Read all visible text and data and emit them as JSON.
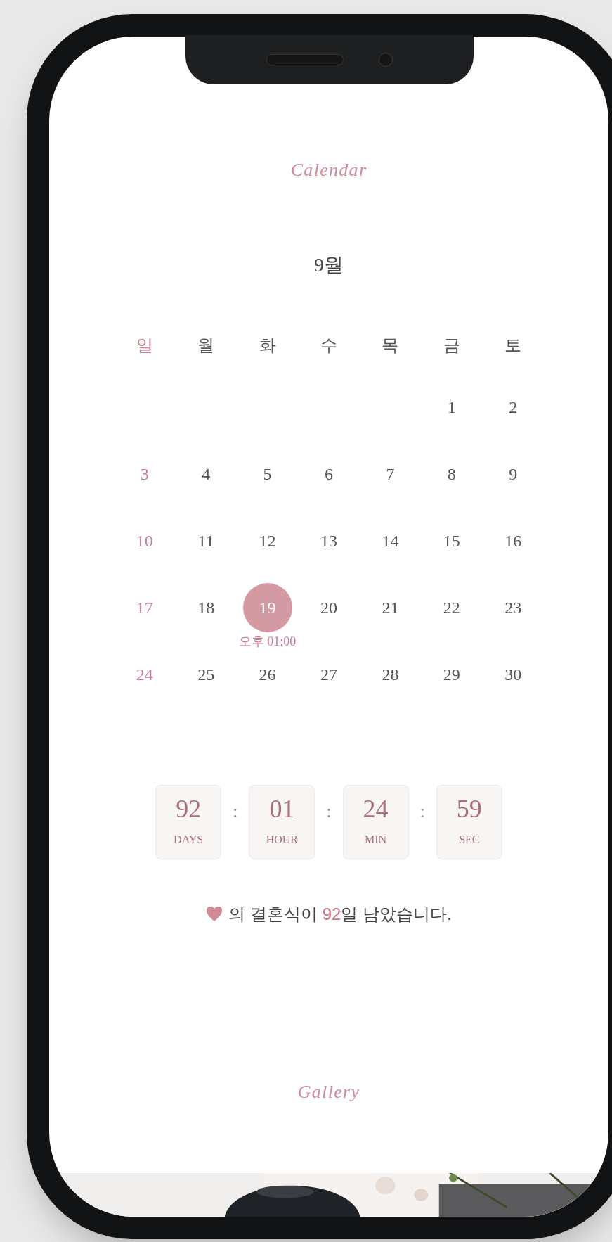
{
  "calendar": {
    "title": "Calendar",
    "month": "9월",
    "weekdays": [
      "일",
      "월",
      "화",
      "수",
      "목",
      "금",
      "토"
    ],
    "weeks": [
      [
        {
          "kind": "blank"
        },
        {
          "kind": "blank"
        },
        {
          "kind": "blank"
        },
        {
          "kind": "blank"
        },
        {
          "kind": "blank"
        },
        {
          "day": "1",
          "selected": false
        },
        {
          "day": "2",
          "selected": false
        }
      ],
      [
        {
          "day": "3",
          "selected": false
        },
        {
          "day": "4",
          "selected": false
        },
        {
          "day": "5",
          "selected": false
        },
        {
          "day": "6",
          "selected": false
        },
        {
          "day": "7",
          "selected": false
        },
        {
          "day": "8",
          "selected": false
        },
        {
          "day": "9",
          "selected": false
        }
      ],
      [
        {
          "day": "10",
          "selected": false
        },
        {
          "day": "11",
          "selected": false
        },
        {
          "day": "12",
          "selected": false
        },
        {
          "day": "13",
          "selected": false
        },
        {
          "day": "14",
          "selected": false
        },
        {
          "day": "15",
          "selected": false
        },
        {
          "day": "16",
          "selected": false
        }
      ],
      [
        {
          "day": "17",
          "selected": false
        },
        {
          "day": "18",
          "selected": false
        },
        {
          "day": "19",
          "selected": true,
          "note": "오후 01:00"
        },
        {
          "day": "20",
          "selected": false
        },
        {
          "day": "21",
          "selected": false
        },
        {
          "day": "22",
          "selected": false
        },
        {
          "day": "23",
          "selected": false
        }
      ],
      [
        {
          "day": "24",
          "selected": false
        },
        {
          "day": "25",
          "selected": false
        },
        {
          "day": "26",
          "selected": false
        },
        {
          "day": "27",
          "selected": false
        },
        {
          "day": "28",
          "selected": false
        },
        {
          "day": "29",
          "selected": false
        },
        {
          "day": "30",
          "selected": false
        }
      ]
    ]
  },
  "countdown": {
    "units": [
      {
        "value": "92",
        "label": "DAYS"
      },
      {
        "value": "01",
        "label": "HOUR"
      },
      {
        "value": "24",
        "label": "MIN"
      },
      {
        "value": "59",
        "label": "SEC"
      }
    ],
    "separator": ":",
    "message": {
      "before": "의 결혼식이 ",
      "highlight": "92",
      "after": "일 남았습니다."
    }
  },
  "gallery": {
    "title": "Gallery"
  }
}
